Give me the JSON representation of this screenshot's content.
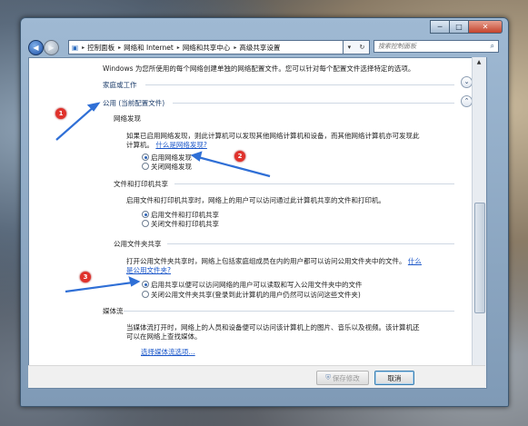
{
  "address_bar": {
    "path": [
      "控制面板",
      "网络和 Internet",
      "网络和共享中心",
      "高级共享设置"
    ],
    "search_placeholder": "搜索控制面板"
  },
  "window_buttons": {
    "minimize": "─",
    "maximize": "□",
    "close": "✕"
  },
  "intro": "Windows 为您所使用的每个网络创建单独的网络配置文件。您可以针对每个配置文件选择特定的选项。",
  "profiles": {
    "home_work": "家庭或工作",
    "public": "公用 (当前配置文件)"
  },
  "network_discovery": {
    "heading": "网络发现",
    "desc_line1": "如果已启用网络发现，则此计算机可以发现其他网络计算机和设备，而其他网络计算机亦可发现此",
    "desc_line2": "计算机。",
    "link": "什么是网络发现?",
    "options": [
      "启用网络发现",
      "关闭网络发现"
    ],
    "selected": 0
  },
  "file_printer": {
    "heading": "文件和打印机共享",
    "desc": "启用文件和打印机共享时，网络上的用户可以访问通过此计算机共享的文件和打印机。",
    "options": [
      "启用文件和打印机共享",
      "关闭文件和打印机共享"
    ],
    "selected": 0
  },
  "public_folder": {
    "heading": "公用文件夹共享",
    "desc_line1": "打开公用文件夹共享时，网络上包括家庭组成员在内的用户都可以访问公用文件夹中的文件。",
    "link_part1": "什么",
    "link_part2": "是公用文件夹?",
    "options": [
      "启用共享以便可以访问网络的用户可以读取和写入公用文件夹中的文件",
      "关闭公用文件夹共享(登录到此计算机的用户仍然可以访问这些文件夹)"
    ],
    "selected": 0
  },
  "media": {
    "heading": "媒体流",
    "desc_line1": "当媒体流打开时，网络上的人员和设备便可以访问该计算机上的图片、音乐以及视频。该计算机还",
    "desc_line2": "可以在网络上查找媒体。",
    "link": "选择媒体流选项..."
  },
  "buttons": {
    "save": "保存修改",
    "cancel": "取消"
  },
  "annotations": [
    "1",
    "2",
    "3"
  ],
  "colors": {
    "annotation_red": "#e0322c",
    "arrow_blue": "#2f6fd6",
    "link": "#1a56c9"
  }
}
